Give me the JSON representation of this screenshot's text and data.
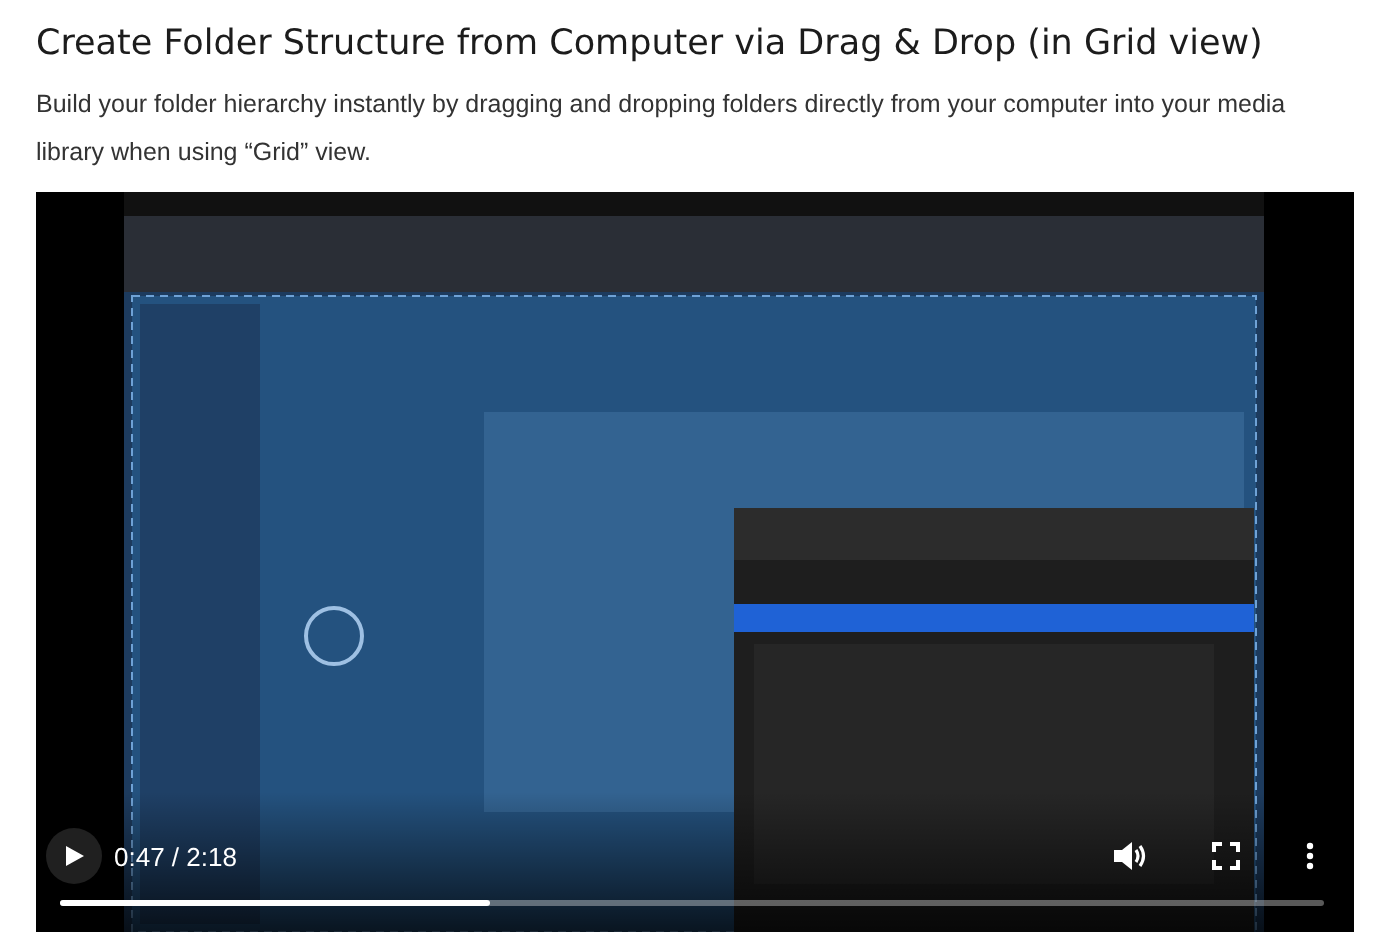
{
  "heading": "Create Folder Structure from Computer via Drag & Drop (in Grid view)",
  "description": "Build your folder hierarchy instantly by dragging and dropping folders directly from your computer into your media library when using “Grid” view.",
  "video": {
    "kind": "picture",
    "playing": false,
    "time": "0:47 / 2:18",
    "progress": {
      "level": 0.34
    }
  }
}
